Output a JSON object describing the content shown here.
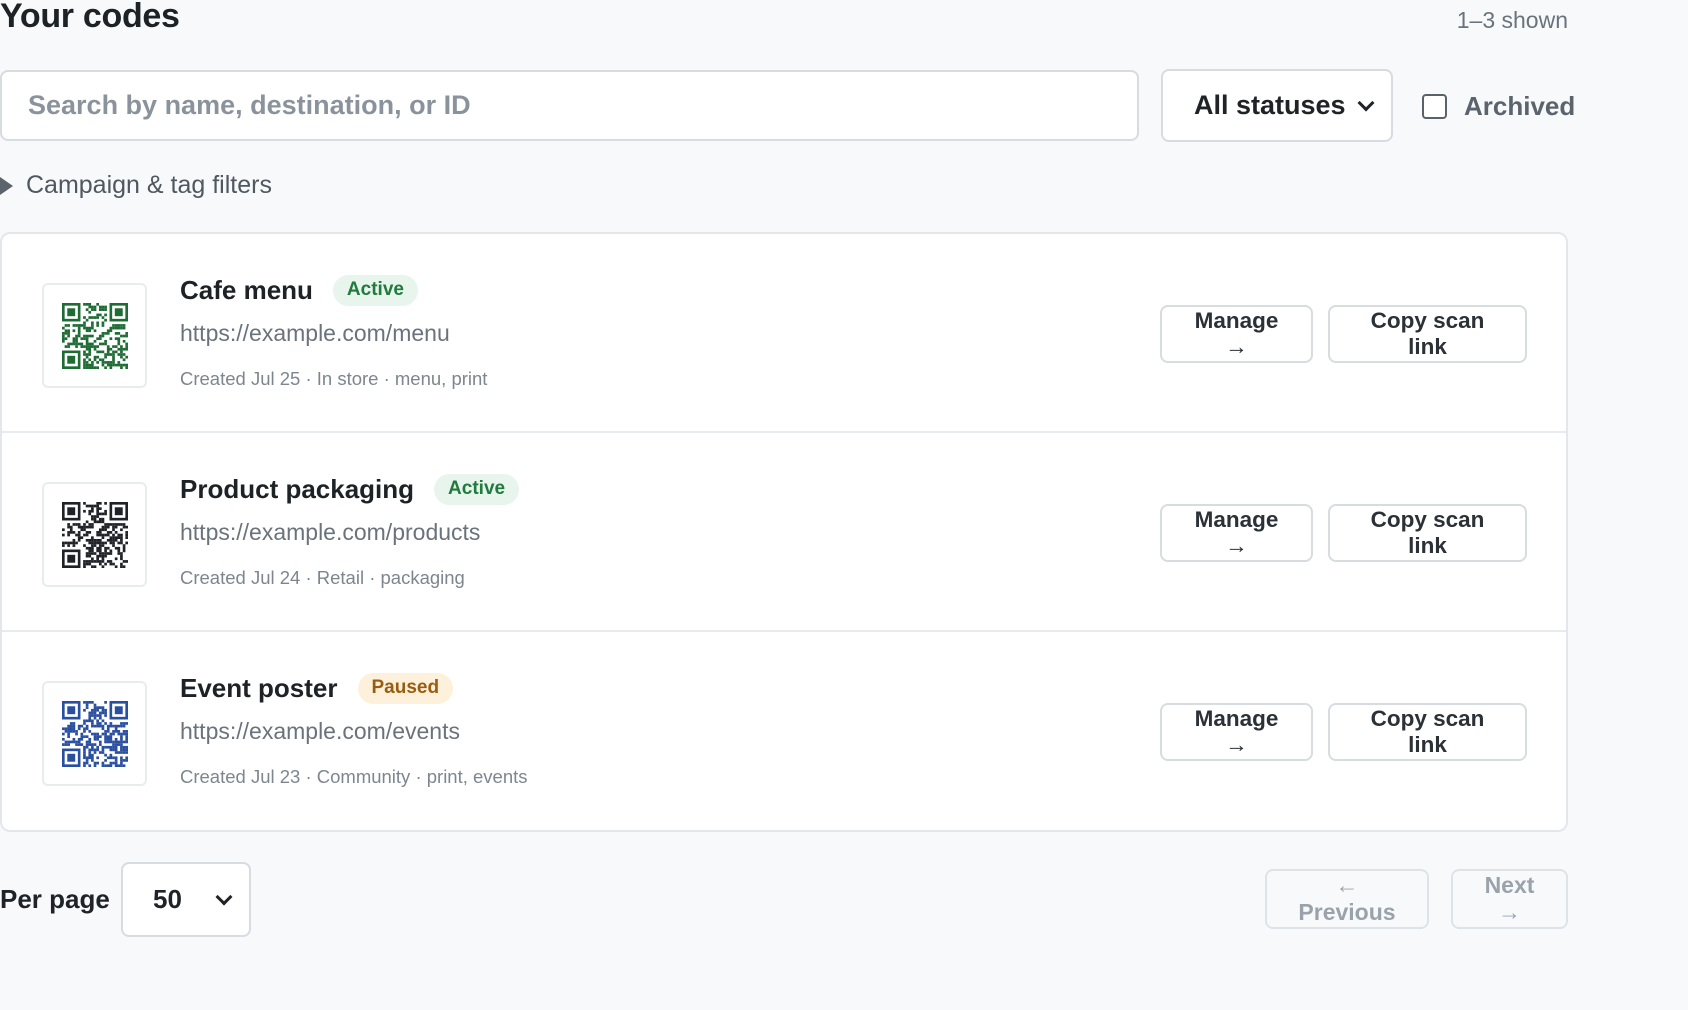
{
  "header": {
    "title": "Your codes",
    "shown_count": "1–3 shown"
  },
  "search": {
    "placeholder": "Search by name, destination, or ID",
    "value": ""
  },
  "status_filter": {
    "selected": "All statuses"
  },
  "archived": {
    "label": "Archived",
    "checked": false
  },
  "filters": {
    "label": "Campaign & tag filters"
  },
  "codes": [
    {
      "name": "Cafe menu",
      "status": "Active",
      "url": "https://example.com/menu",
      "meta": "Created Jul 25 · In store · menu, print",
      "qr_color": "#1e6b34",
      "manage_label": "Manage →",
      "copy_label": "Copy scan link"
    },
    {
      "name": "Product packaging",
      "status": "Active",
      "url": "https://example.com/products",
      "meta": "Created Jul 24 · Retail · packaging",
      "qr_color": "#1f2328",
      "manage_label": "Manage →",
      "copy_label": "Copy scan link"
    },
    {
      "name": "Event poster",
      "status": "Paused",
      "url": "https://example.com/events",
      "meta": "Created Jul 23 · Community · print, events",
      "qr_color": "#2a4fa0",
      "manage_label": "Manage →",
      "copy_label": "Copy scan link"
    }
  ],
  "pagination": {
    "per_page_label": "Per page",
    "per_page_value": "50",
    "previous_label": "← Previous",
    "next_label": "Next →"
  },
  "colors": {
    "active_badge_bg": "#e7f5ec",
    "active_badge_text": "#217a3e",
    "paused_badge_bg": "#fdf1dc",
    "paused_badge_text": "#9a5d0f"
  },
  "icons": {
    "status_chevron": "chevron-down-icon",
    "filters_disclosure": "caret-right-icon",
    "qr_thumbnail": "qr-code-icon"
  }
}
